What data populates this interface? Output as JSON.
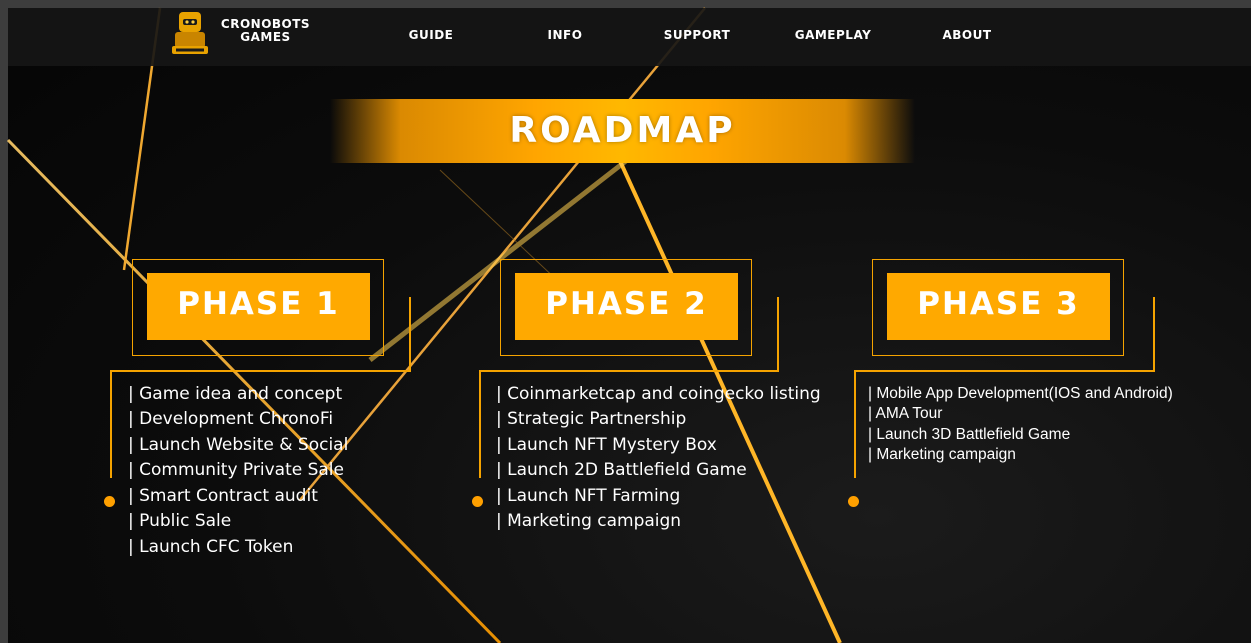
{
  "nav": {
    "brand_line1": "CRONOBOTS",
    "brand_line2": "GAMES",
    "logo_icon": "robot-mascot-icon",
    "links": [
      "GUIDE",
      "INFO",
      "SUPPORT",
      "GAMEPLAY",
      "ABOUT"
    ]
  },
  "roadmap": {
    "title": "ROADMAP"
  },
  "phases": [
    {
      "label": "PHASE 1",
      "items": [
        "| Game idea and concept",
        "| Development ChronoFi",
        "| Launch Website & Social",
        "| Community Private Sale",
        "| Smart Contract audit",
        "| Public Sale",
        "| Launch CFC Token"
      ]
    },
    {
      "label": "PHASE 2",
      "items": [
        "| Coinmarketcap and coingecko listing",
        "| Strategic Partnership",
        "| Launch NFT Mystery Box",
        "| Launch 2D Battlefield Game",
        "| Launch NFT Farming",
        "| Marketing campaign"
      ]
    },
    {
      "label": "PHASE 3",
      "items": [
        "| Mobile App Development(IOS and Android)",
        "| AMA Tour",
        "| Launch 3D Battlefield Game",
        "| Marketing campaign"
      ]
    }
  ],
  "colors": {
    "accent": "#ffa900",
    "background": "#0c0c0c",
    "text": "#ffffff"
  }
}
